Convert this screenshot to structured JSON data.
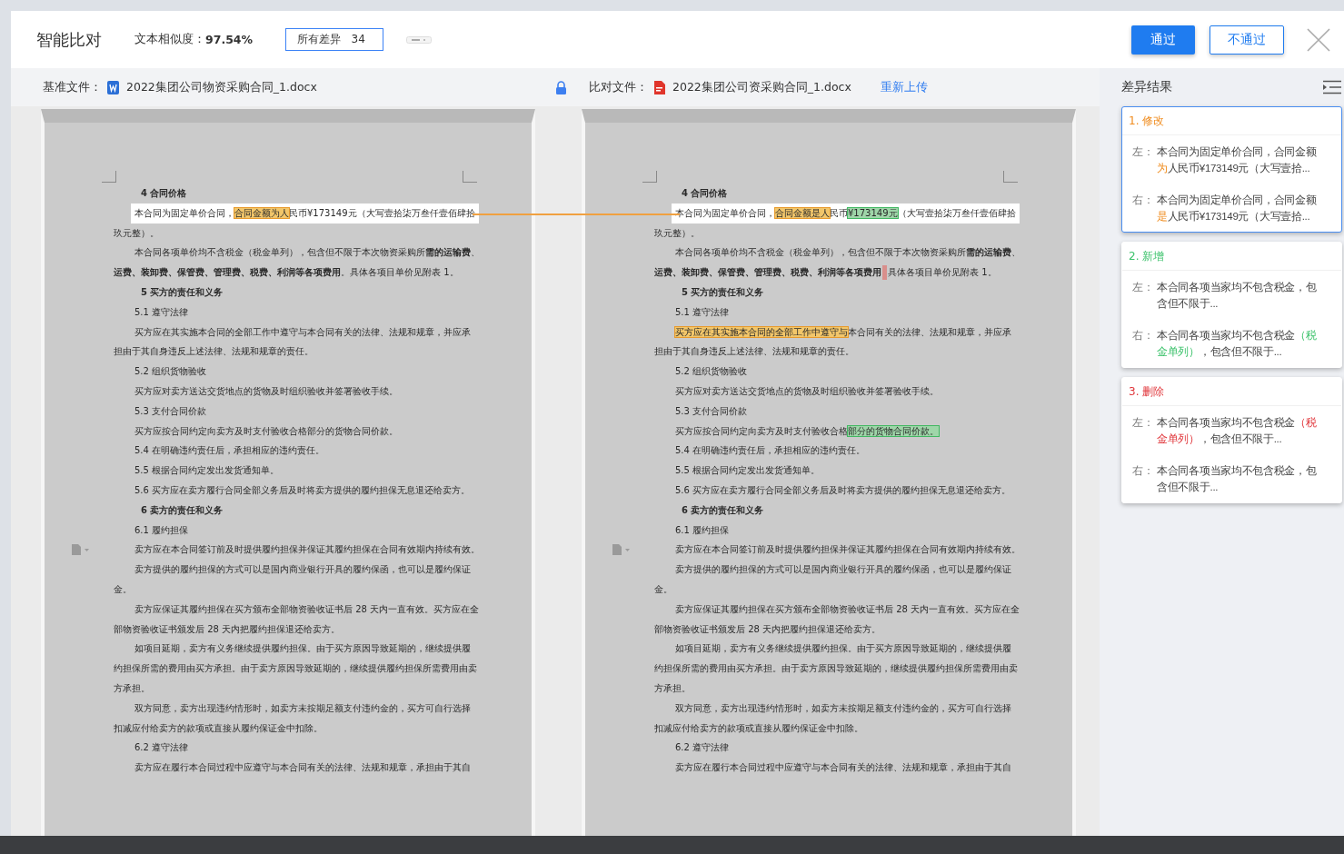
{
  "header": {
    "title": "智能比对",
    "similarity_label": "文本相似度：",
    "similarity_value": "97.54%",
    "filter": {
      "label": "所有差异",
      "count": "34"
    },
    "buttons": [
      {
        "label": "通过",
        "kind": "primary"
      },
      {
        "label": "不通过",
        "kind": "outline"
      }
    ]
  },
  "files": {
    "base": {
      "label": "基准文件：",
      "kind": "word",
      "name": "2022集团公司物资采购合同_1.docx"
    },
    "compare": {
      "label": "比对文件：",
      "kind": "pdf",
      "name": "2022集团公司资采购合同_1.docx"
    },
    "reupload": "重新上传"
  },
  "documents": [
    {
      "lines": [
        {
          "kind": "heading",
          "focused": false,
          "segments": [
            {
              "text": "4 合同价格"
            }
          ]
        },
        {
          "kind": "indent",
          "focused": true,
          "segments": [
            {
              "text": "本合同为固定单价合同，"
            },
            {
              "text": "合同金额为人",
              "kind": "modified"
            },
            {
              "text": "民币¥173149元（大写壹拾柒万叁仟壹佰肆拾"
            }
          ]
        },
        {
          "kind": "plain",
          "focused": false,
          "segments": [
            {
              "text": "玖元整）。"
            }
          ]
        },
        {
          "kind": "indent",
          "focused": false,
          "segments": [
            {
              "text": "本合同各项单价均不含税金（税金单列），包含但不限于本次物资采购所**需的运输费**、"
            }
          ]
        },
        {
          "kind": "plain",
          "focused": false,
          "segments": [
            {
              "text": "**运费、装卸费、保管费、管理费、税费、利润等各项费用**。具体各项目单价见附表 1。"
            }
          ]
        },
        {
          "kind": "heading",
          "focused": false,
          "segments": [
            {
              "text": "5 买方的责任和义务"
            }
          ]
        },
        {
          "kind": "sub",
          "focused": false,
          "segments": [
            {
              "text": "5.1 遵守法律"
            }
          ]
        },
        {
          "kind": "indent",
          "focused": false,
          "segments": [
            {
              "text": "买方应在其实施本合同的全部工作中遵守与本合同有关的法律、法规和规章，并应承"
            }
          ]
        },
        {
          "kind": "plain",
          "focused": false,
          "segments": [
            {
              "text": "担由于其自身违反上述法律、法规和规章的责任。"
            }
          ]
        },
        {
          "kind": "sub",
          "focused": false,
          "segments": [
            {
              "text": "5.2 组织货物验收"
            }
          ]
        },
        {
          "kind": "indent",
          "focused": false,
          "segments": [
            {
              "text": "买方应对卖方送达交货地点的货物及时组织验收并签署验收手续。"
            }
          ]
        },
        {
          "kind": "sub",
          "focused": false,
          "segments": [
            {
              "text": "5.3 支付合同价款"
            }
          ]
        },
        {
          "kind": "indent",
          "focused": false,
          "segments": [
            {
              "text": "买方应按合同约定向卖方及时支付验收合格部分的货物合同价款。"
            }
          ]
        },
        {
          "kind": "sub",
          "focused": false,
          "segments": [
            {
              "text": "5.4 在明确违约责任后，承担相应的违约责任。"
            }
          ]
        },
        {
          "kind": "sub",
          "focused": false,
          "segments": [
            {
              "text": "5.5  根据合同约定发出发货通知单。"
            }
          ]
        },
        {
          "kind": "sub",
          "focused": false,
          "segments": [
            {
              "text": "5.6  买方应在卖方履行合同全部义务后及时将卖方提供的履约担保无息退还给卖方。"
            }
          ]
        },
        {
          "kind": "heading",
          "focused": false,
          "segments": [
            {
              "text": "6 卖方的责任和义务"
            }
          ]
        },
        {
          "kind": "sub",
          "focused": false,
          "segments": [
            {
              "text": "6.1 履约担保"
            }
          ]
        },
        {
          "kind": "indent",
          "focused": false,
          "segments": [
            {
              "text": "卖方应在本合同签订前及时提供履约担保并保证其履约担保在合同有效期内持续有效。"
            }
          ]
        },
        {
          "kind": "indent",
          "focused": false,
          "segments": [
            {
              "text": "卖方提供的履约担保的方式可以是国内商业银行开具的履约保函，也可以是履约保证"
            }
          ]
        },
        {
          "kind": "plain",
          "focused": false,
          "segments": [
            {
              "text": "金。"
            }
          ]
        },
        {
          "kind": "indent",
          "focused": false,
          "segments": [
            {
              "text": "卖方应保证其履约担保在买方颁布全部物资验收证书后 28 天内一直有效。买方应在全"
            }
          ]
        },
        {
          "kind": "plain",
          "focused": false,
          "segments": [
            {
              "text": "部物资验收证书颁发后 28 天内把履约担保退还给卖方。"
            }
          ]
        },
        {
          "kind": "indent",
          "focused": false,
          "segments": [
            {
              "text": "如项目延期，卖方有义务继续提供履约担保。由于买方原因导致延期的，继续提供履"
            }
          ]
        },
        {
          "kind": "plain",
          "focused": false,
          "segments": [
            {
              "text": "约担保所需的费用由买方承担。由于卖方原因导致延期的，继续提供履约担保所需费用由卖"
            }
          ]
        },
        {
          "kind": "plain",
          "focused": false,
          "segments": [
            {
              "text": "方承担。"
            }
          ]
        },
        {
          "kind": "indent",
          "focused": false,
          "segments": [
            {
              "text": "双方同意，卖方出现违约情形时，如卖方未按期足额支付违约金的，买方可自行选择"
            }
          ]
        },
        {
          "kind": "plain",
          "focused": false,
          "segments": [
            {
              "text": "扣减应付给卖方的款项或直接从履约保证金中扣除。"
            }
          ]
        },
        {
          "kind": "sub",
          "focused": false,
          "segments": [
            {
              "text": "6.2 遵守法律"
            }
          ]
        },
        {
          "kind": "indent",
          "focused": false,
          "segments": [
            {
              "text": "卖方应在履行本合同过程中应遵守与本合同有关的法律、法规和规章，承担由于其自"
            }
          ]
        }
      ]
    },
    {
      "lines": [
        {
          "kind": "heading",
          "focused": false,
          "segments": [
            {
              "text": "4 合同价格"
            }
          ]
        },
        {
          "kind": "indent",
          "focused": true,
          "segments": [
            {
              "text": "本合同为固定单价合同，"
            },
            {
              "text": "合同金额是人",
              "kind": "modified"
            },
            {
              "text": "民币"
            },
            {
              "text": "¥173149元",
              "kind": "added"
            },
            {
              "text": "（大写壹拾柒万叁仟壹佰肆拾"
            }
          ]
        },
        {
          "kind": "plain",
          "focused": false,
          "segments": [
            {
              "text": "玖元整）。"
            }
          ]
        },
        {
          "kind": "indent",
          "focused": false,
          "segments": [
            {
              "text": "本合同各项单价均不含税金（税金单列），包含但不限于本次物资采购所**需的运输费**、"
            }
          ]
        },
        {
          "kind": "plain",
          "focused": false,
          "segments": [
            {
              "text": "**运费、装卸费、保管费、管理费、税费、利润等各项费用**"
            },
            {
              "kind": "deleted"
            },
            {
              "text": "具体各项目单价见附表 1。"
            }
          ]
        },
        {
          "kind": "heading",
          "focused": false,
          "segments": [
            {
              "text": "5 买方的责任和义务"
            }
          ]
        },
        {
          "kind": "sub",
          "focused": false,
          "segments": [
            {
              "text": "5.1 遵守法律"
            }
          ]
        },
        {
          "kind": "indent",
          "focused": false,
          "segments": [
            {
              "text": "买方应在其实施本合同的全部工作中遵守与",
              "kind": "modified"
            },
            {
              "text": "本合同有关的法律、法规和规章，并应承"
            }
          ]
        },
        {
          "kind": "plain",
          "focused": false,
          "segments": [
            {
              "text": "担由于其自身违反上述法律、法规和规章的责任。"
            }
          ]
        },
        {
          "kind": "sub",
          "focused": false,
          "segments": [
            {
              "text": "5.2 组织货物验收"
            }
          ]
        },
        {
          "kind": "indent",
          "focused": false,
          "segments": [
            {
              "text": "买方应对卖方送达交货地点的货物及时组织验收并签署验收手续。"
            }
          ]
        },
        {
          "kind": "sub",
          "focused": false,
          "segments": [
            {
              "text": "5.3 支付合同价款"
            }
          ]
        },
        {
          "kind": "indent",
          "focused": false,
          "segments": [
            {
              "text": "买方应按合同约定向卖方及时支付验收合格"
            },
            {
              "text": "部分的货物合同价款。",
              "kind": "added"
            }
          ]
        },
        {
          "kind": "sub",
          "focused": false,
          "segments": [
            {
              "text": "5.4 在明确违约责任后，承担相应的违约责任。"
            }
          ]
        },
        {
          "kind": "sub",
          "focused": false,
          "segments": [
            {
              "text": "5.5  根据合同约定发出发货通知单。"
            }
          ]
        },
        {
          "kind": "sub",
          "focused": false,
          "segments": [
            {
              "text": "5.6  买方应在卖方履行合同全部义务后及时将卖方提供的履约担保无息退还给卖方。"
            }
          ]
        },
        {
          "kind": "heading",
          "focused": false,
          "segments": [
            {
              "text": "6 卖方的责任和义务"
            }
          ]
        },
        {
          "kind": "sub",
          "focused": false,
          "segments": [
            {
              "text": "6.1 履约担保"
            }
          ]
        },
        {
          "kind": "indent",
          "focused": false,
          "segments": [
            {
              "text": "卖方应在本合同签订前及时提供履约担保并保证其履约担保在合同有效期内持续有效。"
            }
          ]
        },
        {
          "kind": "indent",
          "focused": false,
          "segments": [
            {
              "text": "卖方提供的履约担保的方式可以是国内商业银行开具的履约保函，也可以是履约保证"
            }
          ]
        },
        {
          "kind": "plain",
          "focused": false,
          "segments": [
            {
              "text": "金。"
            }
          ]
        },
        {
          "kind": "indent",
          "focused": false,
          "segments": [
            {
              "text": "卖方应保证其履约担保在买方颁布全部物资验收证书后 28 天内一直有效。买方应在全"
            }
          ]
        },
        {
          "kind": "plain",
          "focused": false,
          "segments": [
            {
              "text": "部物资验收证书颁发后 28 天内把履约担保退还给卖方。"
            }
          ]
        },
        {
          "kind": "indent",
          "focused": false,
          "segments": [
            {
              "text": "如项目延期，卖方有义务继续提供履约担保。由于买方原因导致延期的，继续提供履"
            }
          ]
        },
        {
          "kind": "plain",
          "focused": false,
          "segments": [
            {
              "text": "约担保所需的费用由买方承担。由于卖方原因导致延期的，继续提供履约担保所需费用由卖"
            }
          ]
        },
        {
          "kind": "plain",
          "focused": false,
          "segments": [
            {
              "text": "方承担。"
            }
          ]
        },
        {
          "kind": "indent",
          "focused": false,
          "segments": [
            {
              "text": "双方同意，卖方出现违约情形时，如卖方未按期足额支付违约金的，买方可自行选择"
            }
          ]
        },
        {
          "kind": "plain",
          "focused": false,
          "segments": [
            {
              "text": "扣减应付给卖方的款项或直接从履约保证金中扣除。"
            }
          ]
        },
        {
          "kind": "sub",
          "focused": false,
          "segments": [
            {
              "text": "6.2 遵守法律"
            }
          ]
        },
        {
          "kind": "indent",
          "focused": false,
          "segments": [
            {
              "text": "卖方应在履行本合同过程中应遵守与本合同有关的法律、法规和规章，承担由于其自"
            }
          ]
        }
      ]
    }
  ],
  "results": {
    "title": "差异结果",
    "items": [
      {
        "number": "1.",
        "type": "修改",
        "kind": "modified",
        "selected": true,
        "rows": [
          {
            "label": "左：",
            "segments": [
              {
                "text": "本合同为固定单价合同，合同金额"
              },
              {
                "text": "为",
                "kind": "modified"
              },
              {
                "text": "人民币¥173149元（大写壹拾..."
              }
            ]
          },
          {
            "label": "右：",
            "segments": [
              {
                "text": "本合同为固定单价合同，合同金额"
              },
              {
                "text": "是",
                "kind": "modified"
              },
              {
                "text": "人民币¥173149元（大写壹拾..."
              }
            ]
          }
        ]
      },
      {
        "number": "2.",
        "type": "新增",
        "kind": "added",
        "selected": false,
        "rows": [
          {
            "label": "左：",
            "segments": [
              {
                "text": "本合同各项当家均不包含税金，包含但不限于..."
              }
            ]
          },
          {
            "label": "右：",
            "segments": [
              {
                "text": "本合同各项当家均不包含税金"
              },
              {
                "text": "（税金单列）",
                "kind": "added"
              },
              {
                "text": "，包含但不限于..."
              }
            ]
          }
        ]
      },
      {
        "number": "3.",
        "type": "删除",
        "kind": "deleted",
        "selected": false,
        "rows": [
          {
            "label": "左：",
            "segments": [
              {
                "text": "本合同各项当家均不包含税金"
              },
              {
                "text": "（税金单列）",
                "kind": "deleted"
              },
              {
                "text": "，包含但不限于..."
              }
            ]
          },
          {
            "label": "右：",
            "segments": [
              {
                "text": "本合同各项当家均不包含税金，包含但不限于..."
              }
            ]
          }
        ]
      }
    ]
  }
}
